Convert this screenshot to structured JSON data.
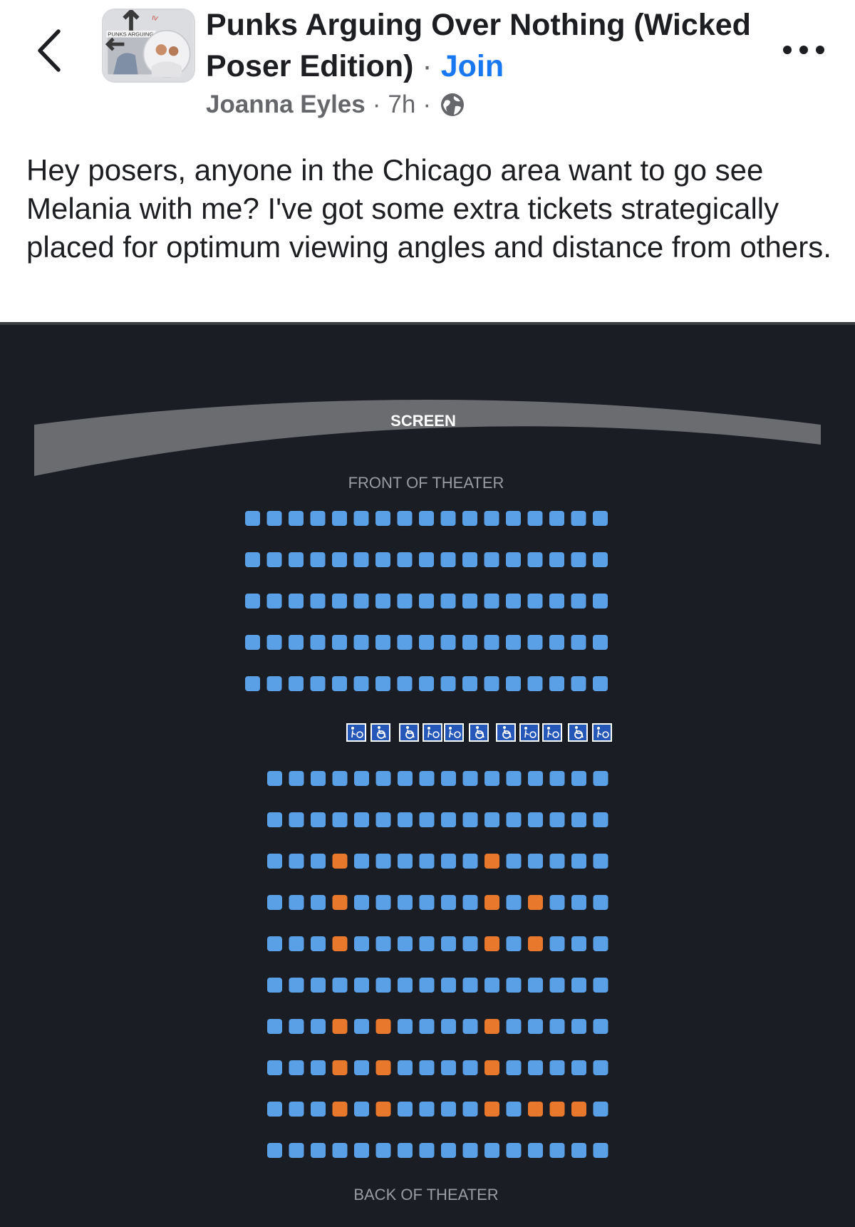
{
  "header": {
    "back_icon": "chevron-left-icon",
    "group_name": "Punks Arguing Over Nothing (Wicked Poser Edition)",
    "separator": "·",
    "join_label": "Join",
    "author": "Joanna Eyles",
    "meta_separator": "·",
    "time": "7h",
    "privacy_icon": "globe-icon",
    "more_icon": "more-horizontal-icon",
    "avatar_caption": "PUNKS ARGUING O"
  },
  "post": {
    "text": "Hey posers, anyone in the Chicago area want to go see Melania with me? I've got some extra tickets strategically placed for optimum viewing angles and distance from others."
  },
  "seat_map": {
    "screen_label": "SCREEN",
    "front_label": "FRONT OF THEATER",
    "back_label": "BACK OF THEATER",
    "colors": {
      "background": "#1b1d24",
      "available": "#5aa0e6",
      "selected": "#e8782c",
      "accessible": "#2457b8",
      "screen": "#6b6c70"
    },
    "front_rows": [
      {
        "seats": 17,
        "selected": []
      },
      {
        "seats": 17,
        "selected": []
      },
      {
        "seats": 17,
        "selected": []
      },
      {
        "seats": 17,
        "selected": []
      },
      {
        "seats": 17,
        "selected": []
      }
    ],
    "accessible_row": [
      "companion-seat-icon",
      "wheelchair-icon",
      "wheelchair-icon",
      "companion-seat-icon",
      "companion-seat-icon",
      "wheelchair-icon",
      "wheelchair-icon",
      "companion-seat-icon",
      "companion-seat-icon",
      "wheelchair-icon",
      "companion-seat-icon"
    ],
    "back_rows": [
      {
        "seats": 16,
        "selected": []
      },
      {
        "seats": 16,
        "selected": []
      },
      {
        "seats": 16,
        "selected": [
          3,
          10
        ]
      },
      {
        "seats": 16,
        "selected": [
          3,
          10,
          12
        ]
      },
      {
        "seats": 16,
        "selected": [
          3,
          10,
          12
        ]
      },
      {
        "seats": 16,
        "selected": []
      },
      {
        "seats": 16,
        "selected": [
          3,
          5,
          10
        ]
      },
      {
        "seats": 16,
        "selected": [
          3,
          5,
          10
        ]
      },
      {
        "seats": 16,
        "selected": [
          3,
          5,
          10,
          12,
          13,
          14
        ]
      },
      {
        "seats": 16,
        "selected": []
      }
    ]
  }
}
